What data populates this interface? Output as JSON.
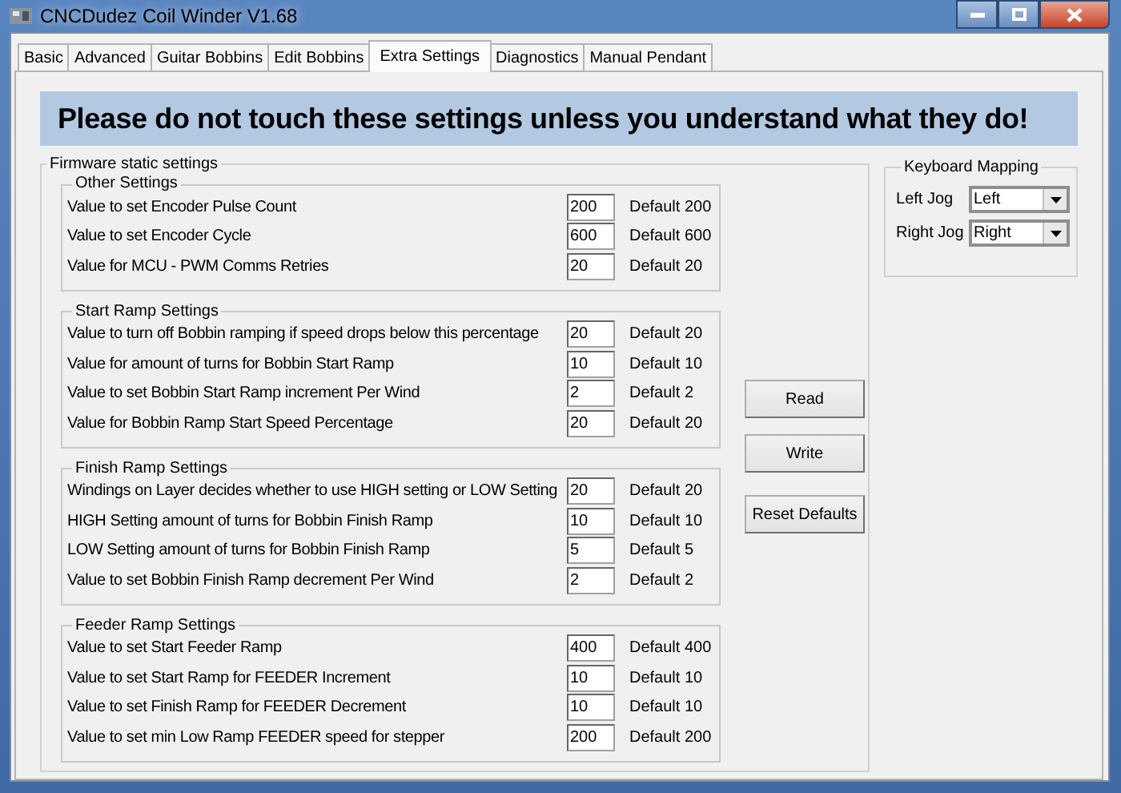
{
  "window": {
    "title": "CNCDudez Coil Winder V1.68"
  },
  "tabs": [
    {
      "label": "Basic",
      "selected": false
    },
    {
      "label": "Advanced",
      "selected": false
    },
    {
      "label": "Guitar Bobbins",
      "selected": false
    },
    {
      "label": "Edit Bobbins",
      "selected": false
    },
    {
      "label": "Extra Settings",
      "selected": true
    },
    {
      "label": "Diagnostics",
      "selected": false
    },
    {
      "label": "Manual Pendant",
      "selected": false
    }
  ],
  "banner": "Please do not touch these settings unless you understand what they do!",
  "firmware": {
    "title": "Firmware static settings",
    "sections": [
      {
        "title": "Other Settings",
        "rows": [
          {
            "label": "Value to set Encoder Pulse Count",
            "value": "200",
            "default": "Default 200"
          },
          {
            "label": "Value to set Encoder Cycle",
            "value": "600",
            "default": "Default 600"
          },
          {
            "label": "Value for MCU - PWM Comms Retries",
            "value": "20",
            "default": "Default 20"
          }
        ]
      },
      {
        "title": "Start Ramp Settings",
        "rows": [
          {
            "label": "Value to turn off Bobbin ramping if speed drops below this percentage",
            "value": "20",
            "default": "Default 20"
          },
          {
            "label": "Value for amount of turns for Bobbin Start Ramp",
            "value": "10",
            "default": "Default 10"
          },
          {
            "label": "Value to set Bobbin Start Ramp increment Per Wind",
            "value": "2",
            "default": "Default 2"
          },
          {
            "label": "Value for Bobbin Ramp Start Speed Percentage",
            "value": "20",
            "default": "Default 20"
          }
        ]
      },
      {
        "title": "Finish Ramp Settings",
        "rows": [
          {
            "label": "Windings on Layer decides whether to use HIGH setting or LOW Setting",
            "value": "20",
            "default": "Default 20"
          },
          {
            "label": "HIGH Setting amount of turns for Bobbin Finish Ramp",
            "value": "10",
            "default": "Default 10"
          },
          {
            "label": "LOW Setting amount of turns for Bobbin Finish Ramp",
            "value": "5",
            "default": "Default 5"
          },
          {
            "label": "Value to set Bobbin Finish Ramp decrement Per Wind",
            "value": "2",
            "default": "Default 2"
          }
        ]
      },
      {
        "title": "Feeder Ramp Settings",
        "rows": [
          {
            "label": "Value to set Start Feeder Ramp",
            "value": "400",
            "default": "Default 400"
          },
          {
            "label": "Value to set Start Ramp for FEEDER Increment",
            "value": "10",
            "default": "Default 10"
          },
          {
            "label": "Value to set Finish Ramp for FEEDER Decrement",
            "value": "10",
            "default": "Default 10"
          },
          {
            "label": "Value to set min Low Ramp FEEDER speed for stepper",
            "value": "200",
            "default": "Default 200"
          }
        ]
      }
    ]
  },
  "buttons": [
    "Read",
    "Write",
    "Reset Defaults"
  ],
  "keyboard_mapping": {
    "title": "Keyboard Mapping",
    "rows": [
      {
        "label": "Left Jog",
        "value": "Left"
      },
      {
        "label": "Right Jog",
        "value": "Right"
      }
    ]
  }
}
